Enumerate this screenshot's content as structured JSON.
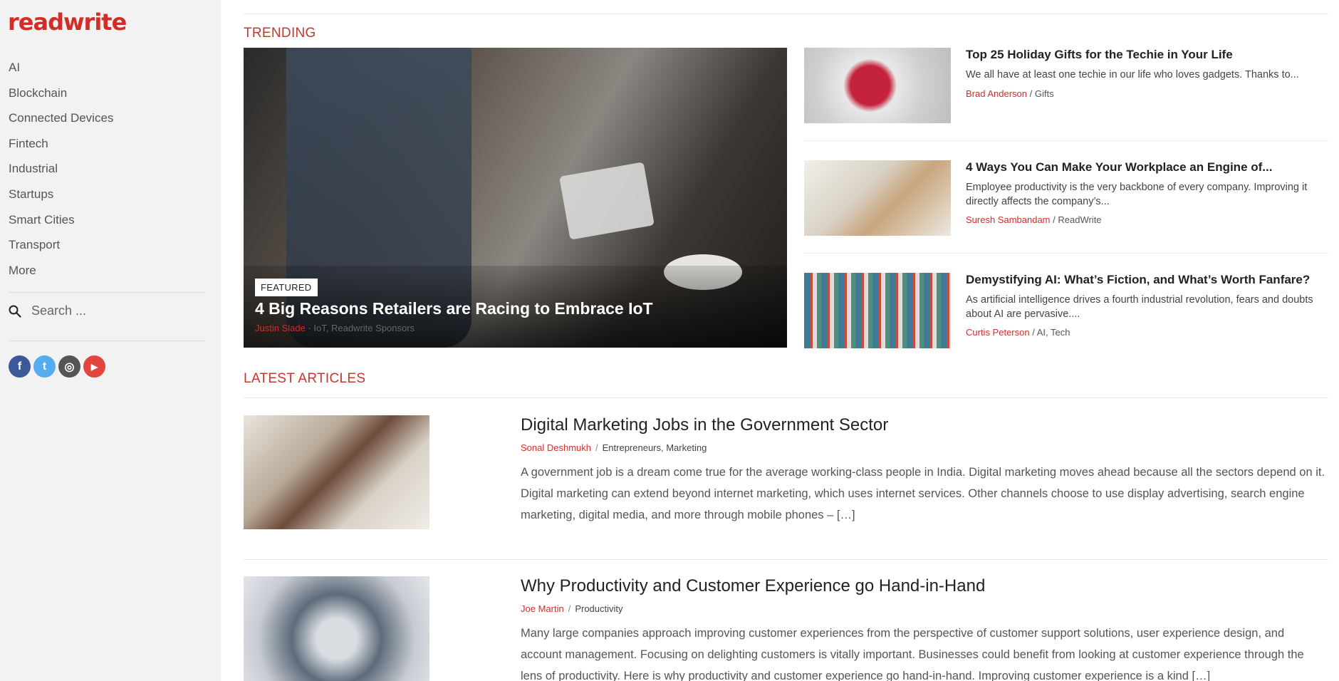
{
  "brand": {
    "logo": "readwrite",
    "accent": "#d12e29"
  },
  "sidebar": {
    "nav": [
      "AI",
      "Blockchain",
      "Connected Devices",
      "Fintech",
      "Industrial",
      "Startups",
      "Smart Cities",
      "Transport",
      "More"
    ],
    "search_placeholder": "Search ...",
    "social": [
      {
        "icon": "facebook-icon",
        "glyph": "f",
        "color": "#3b5998"
      },
      {
        "icon": "twitter-icon",
        "glyph": "t",
        "color": "#55acee"
      },
      {
        "icon": "instagram-icon",
        "glyph": "◎",
        "color": "#555555"
      },
      {
        "icon": "youtube-icon",
        "glyph": "▶",
        "color": "#e2453c"
      }
    ]
  },
  "trending": {
    "heading": "TRENDING",
    "featured": {
      "badge": "FEATURED",
      "title": "4 Big Reasons Retailers are Racing to Embrace IoT",
      "author": "Justin Slade",
      "categories": "IoT, Readwrite Sponsors"
    },
    "items": [
      {
        "title": "Top 25 Holiday Gifts for the Techie in Your Life",
        "excerpt": "We all have at least one techie in our life who loves gadgets. Thanks to...",
        "author": "Brad Anderson",
        "categories": "Gifts"
      },
      {
        "title": "4 Ways You Can Make Your Workplace an Engine of...",
        "excerpt": "Employee productivity is the very backbone of every company. Improving it directly affects the company’s...",
        "author": "Suresh Sambandam",
        "categories": "ReadWrite"
      },
      {
        "title": "Demystifying AI: What’s Fiction, and What’s Worth Fanfare?",
        "excerpt": "As artificial intelligence drives a fourth industrial revolution, fears and doubts about AI are pervasive....",
        "author": "Curtis Peterson",
        "categories": "AI, Tech"
      }
    ]
  },
  "latest": {
    "heading": "LATEST ARTICLES",
    "articles": [
      {
        "title": "Digital Marketing Jobs in the Government Sector",
        "author": "Sonal Deshmukh",
        "categories": "Entrepreneurs, Marketing",
        "excerpt": "A government job is a dream come true for the average working-class people in India. Digital marketing moves ahead because all the sectors depend on it. Digital marketing can extend beyond internet marketing, which uses internet services. Other channels choose to use display advertising, search engine marketing, digital media, and more through mobile phones – […]"
      },
      {
        "title": "Why Productivity and Customer Experience go Hand-in-Hand",
        "author": "Joe Martin",
        "categories": "Productivity",
        "excerpt": "Many large companies approach improving customer experiences from the perspective of customer support solutions, user experience design, and account management. Focusing on delighting customers is vitally important. Businesses could benefit from looking at customer experience through the lens of productivity. Here is why productivity and customer experience go hand-in-hand. Improving customer experience is a kind […]"
      }
    ]
  }
}
